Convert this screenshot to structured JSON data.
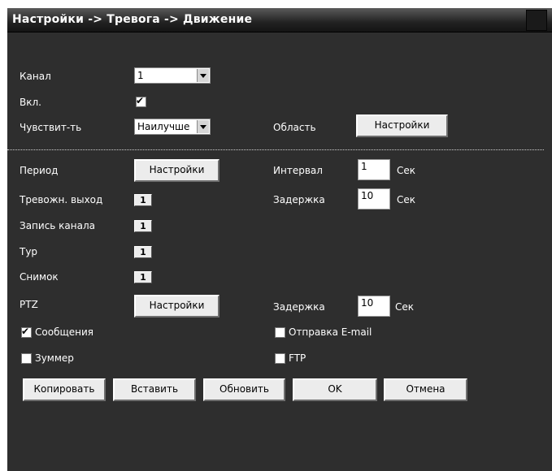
{
  "title": "Настройки -> Тревога -> Движение",
  "fields": {
    "channel_label": "Канал",
    "channel_value": "1",
    "enable_label": "Вкл.",
    "sensitivity_label": "Чувствит-ть",
    "sensitivity_value": "Наилучше",
    "region_label": "Область",
    "region_button": "Настройки",
    "period_label": "Период",
    "period_button": "Настройки",
    "interval_label": "Интервал",
    "interval_value": "1",
    "interval_unit": "Сек",
    "alarm_out_label": "Тревожн. выход",
    "alarm_out_value": "1",
    "delay_label": "Задержка",
    "delay_value": "10",
    "delay_unit": "Сек",
    "record_channel_label": "Запись канала",
    "record_channel_value": "1",
    "tour_label": "Тур",
    "tour_value": "1",
    "snapshot_label": "Снимок",
    "snapshot_value": "1",
    "ptz_label": "PTZ",
    "ptz_button": "Настройки",
    "ptz_delay_label": "Задержка",
    "ptz_delay_value": "10",
    "ptz_delay_unit": "Сек",
    "messages_label": "Сообщения",
    "email_label": "Отправка E-mail",
    "buzzer_label": "Зуммер",
    "ftp_label": "FTP"
  },
  "checkboxes": {
    "enable": true,
    "messages": true,
    "email": false,
    "buzzer": false,
    "ftp": false
  },
  "buttons": {
    "copy": "Копировать",
    "paste": "Вставить",
    "refresh": "Обновить",
    "ok": "OK",
    "cancel": "Отмена"
  }
}
